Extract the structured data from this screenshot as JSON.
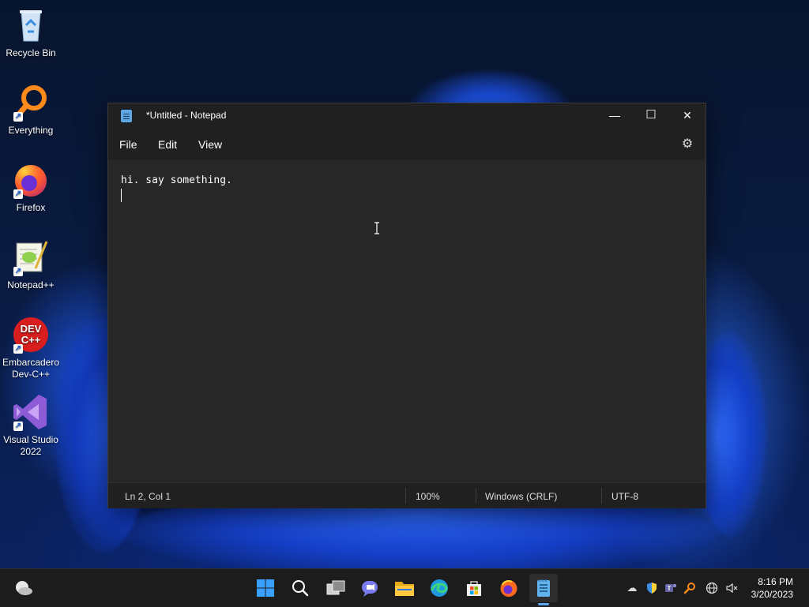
{
  "desktop": {
    "icons": [
      {
        "label": "Recycle Bin",
        "icon": "recycle-bin-icon"
      },
      {
        "label": "Everything",
        "icon": "everything-search-icon"
      },
      {
        "label": "Firefox",
        "icon": "firefox-icon"
      },
      {
        "label": "Notepad++",
        "icon": "notepad-plus-plus-icon"
      },
      {
        "label": "Embarcadero Dev-C++",
        "icon": "devcpp-icon",
        "badge": "DEV C++"
      },
      {
        "label": "Visual Studio 2022",
        "icon": "visual-studio-icon"
      }
    ]
  },
  "notepad": {
    "title": "*Untitled - Notepad",
    "controls": {
      "minimize": "—",
      "maximize": "☐",
      "close": "✕"
    },
    "menu": [
      "File",
      "Edit",
      "View"
    ],
    "content": "hi. say something.",
    "status": {
      "position": "Ln 2, Col 1",
      "zoom": "100%",
      "line_ending": "Windows (CRLF)",
      "encoding": "UTF-8"
    }
  },
  "taskbar": {
    "apps": [
      "start-icon",
      "search-icon",
      "task-view-icon",
      "chat-icon",
      "file-explorer-icon",
      "edge-icon",
      "store-icon",
      "firefox-icon",
      "notepad-icon"
    ],
    "active_app": "notepad-icon",
    "clock": {
      "time": "8:16 PM",
      "date": "3/20/2023"
    }
  },
  "colors": {
    "accent": "#5aa4f0",
    "window_bg": "#272727",
    "chrome_bg": "#202020"
  }
}
